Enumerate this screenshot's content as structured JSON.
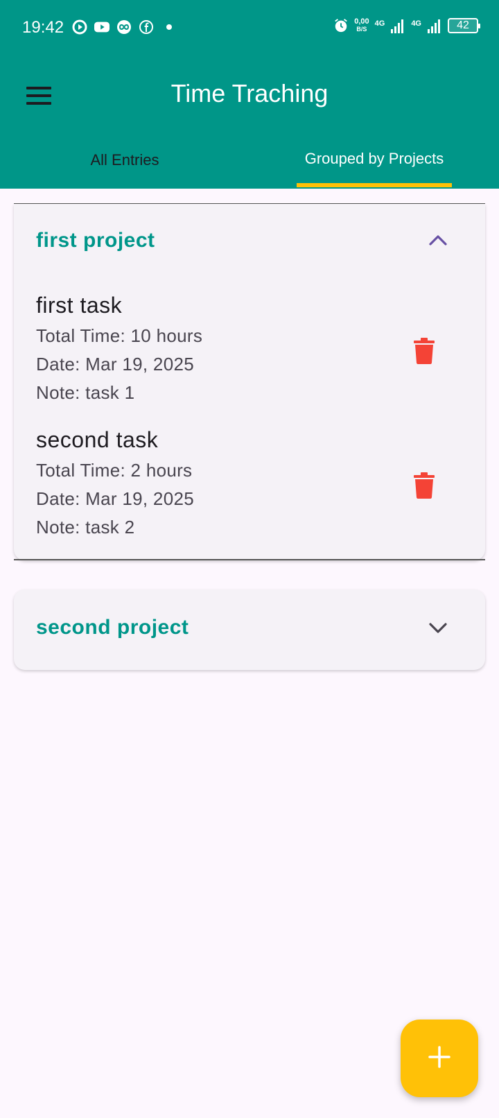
{
  "status_bar": {
    "time": "19:42",
    "net_speed_value": "0,00",
    "net_speed_unit": "B/S",
    "sim1_label": "4G",
    "sim2_label": "4G",
    "battery": "42",
    "icons_left": [
      "screen-record-icon",
      "youtube-icon",
      "infinity-app-icon",
      "facebook-icon"
    ],
    "icons_right": [
      "alarm-icon",
      "signal-icon",
      "signal-icon",
      "battery-icon"
    ]
  },
  "app_bar": {
    "title": "Time Traching",
    "menu_icon": "hamburger-menu-icon",
    "background": "#009688"
  },
  "tabs": [
    {
      "label": "All Entries",
      "selected": false
    },
    {
      "label": "Grouped by Projects",
      "selected": true
    }
  ],
  "tab_indicator_color": "#ffc107",
  "projects": [
    {
      "name": "first project",
      "expanded": true,
      "chevron_icon": "chevron-up-icon",
      "tasks": [
        {
          "name": "first task",
          "total_time": "Total Time: 10 hours",
          "date": "Date: Mar 19, 2025",
          "note": "Note: task 1"
        },
        {
          "name": "second task",
          "total_time": "Total Time: 2 hours",
          "date": "Date: Mar 19, 2025",
          "note": "Note: task 2"
        }
      ]
    },
    {
      "name": "second project",
      "expanded": false,
      "chevron_icon": "chevron-down-icon",
      "tasks": []
    }
  ],
  "colors": {
    "project_title": "#00968a",
    "delete_icon": "#f44336",
    "fab": "#ffc107",
    "page_background": "#fdf7fe",
    "card_background": "#f5f2f7"
  },
  "fab": {
    "icon": "plus-icon"
  }
}
